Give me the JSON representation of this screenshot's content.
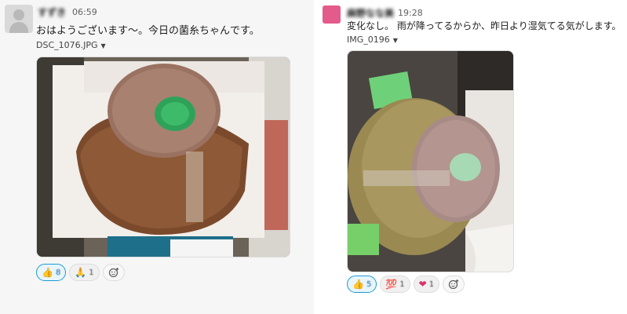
{
  "left": {
    "username": "すずき",
    "time": "06:59",
    "message": "おはようございます〜。今日の菌糸ちゃんです。",
    "file": "DSC_1076.JPG",
    "reactions": [
      {
        "emoji": "👍",
        "count": "8"
      },
      {
        "emoji": "🙏",
        "count": "1"
      }
    ]
  },
  "right": {
    "username": "麻野なな美",
    "time": "19:28",
    "message": "変化なし。 雨が降ってるからか、昨日より湿気てる気がします。",
    "file": "IMG_0196",
    "reactions": [
      {
        "emoji": "👍",
        "count": "5"
      },
      {
        "emoji": "💯",
        "count": "1"
      },
      {
        "emoji": "❤",
        "count": "1"
      }
    ]
  },
  "icons": {
    "caret": "▼",
    "add_reaction": "add-reaction-icon"
  },
  "colors": {
    "accent": "#1d9bd1",
    "avatar_pink": "#e35b8a"
  }
}
